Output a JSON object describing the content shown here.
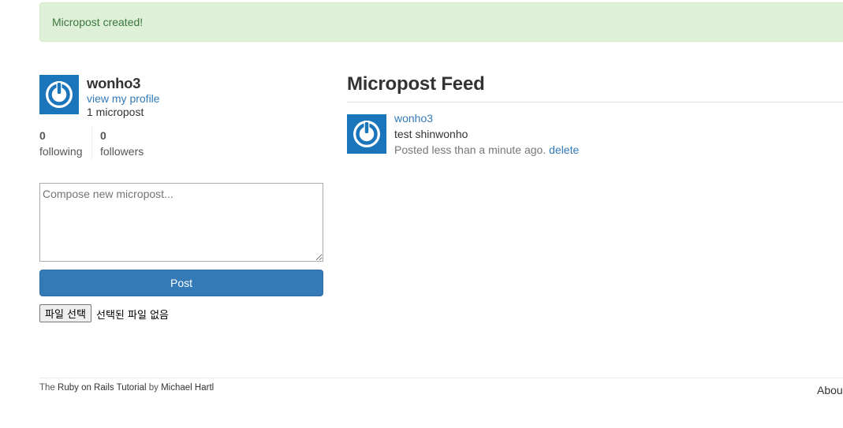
{
  "flash": {
    "message": "Micropost created!",
    "color": "#dff0d8",
    "text_color": "#3c763d"
  },
  "user_info": {
    "name": "wonho3",
    "profile_link": "view my profile",
    "micropost_count": "1 micropost",
    "avatar_icon": "gravatar-power-icon"
  },
  "stats": {
    "following": {
      "count": "0",
      "label": "following"
    },
    "followers": {
      "count": "0",
      "label": "followers"
    }
  },
  "compose": {
    "placeholder": "Compose new micropost...",
    "value": "",
    "submit_label": "Post",
    "file_button_label": "파일 선택",
    "file_status": "선택된 파일 없음"
  },
  "feed": {
    "title": "Micropost Feed",
    "items": [
      {
        "user": "wonho3",
        "content": "test shinwonho",
        "timestamp": "Posted less than a minute ago.",
        "delete_label": "delete"
      }
    ]
  },
  "footer": {
    "credit_prefix": "The",
    "tutorial_link": "Ruby on Rails Tutorial",
    "credit_by": "by",
    "author_link": "Michael Hartl",
    "nav_about": "About"
  },
  "colors": {
    "primary": "#337ab7",
    "gravatar": "#1b75bb",
    "flash_bg": "#dff0d8"
  }
}
